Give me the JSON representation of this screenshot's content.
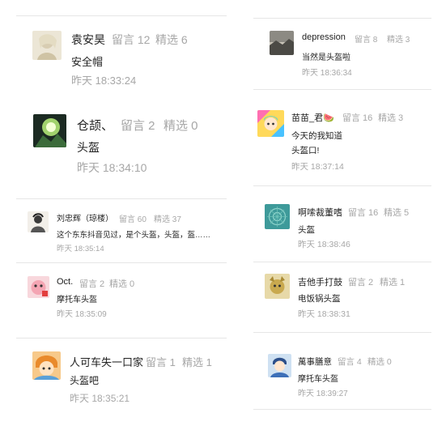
{
  "comments": [
    {
      "user": "袁安昊",
      "msgs": "留言 12",
      "picks": "精选 6",
      "lines": [
        "安全帽"
      ],
      "time": "昨天 18:33:24",
      "avatar": "beige-portrait-avatar"
    },
    {
      "user": "仓颉、",
      "msgs": "留言 2",
      "picks": "精选 0",
      "lines": [
        "头盔"
      ],
      "time": "昨天 18:34:10",
      "avatar": "green-glow-avatar"
    },
    {
      "user": "刘忠辉（琼楼）",
      "msgs": "留言 60",
      "picks": "精选 37",
      "lines": [
        "这个东东抖音见过，是个头盔，头盔，盔……"
      ],
      "time": "昨天 18:35:14",
      "avatar": "ink-portrait-avatar"
    },
    {
      "user": "Oct.",
      "msgs": "留言 2",
      "picks": "精选 0",
      "lines": [
        "摩托车头盔"
      ],
      "time": "昨天 18:35:09",
      "avatar": "pink-cartoon-avatar"
    },
    {
      "user": "人可车失一口家",
      "msgs": "留言 1",
      "picks": "精选 1",
      "lines": [
        "头盔吧"
      ],
      "time": "昨天 18:35:21",
      "avatar": "anime-boy-avatar"
    },
    {
      "user": "depression",
      "msgs": "留言 8",
      "picks": "精选 3",
      "lines": [
        "当然是头盔啦"
      ],
      "time": "昨天 18:36:34",
      "avatar": "landscape-avatar"
    },
    {
      "user": "苗苗_君🍉",
      "msgs": "留言 16",
      "picks": "精选 3",
      "lines": [
        "今天的我知道",
        "头盔口!"
      ],
      "time": "昨天 18:37:14",
      "avatar": "colorful-girl-avatar"
    },
    {
      "user": "啊嗦裁董嗜",
      "msgs": "留言 16",
      "picks": "精选 5",
      "lines": [
        "头盔"
      ],
      "time": "昨天 18:38:46",
      "avatar": "teal-pattern-avatar"
    },
    {
      "user": "吉他手打鼓",
      "msgs": "留言 2",
      "picks": "精选 1",
      "lines": [
        "电饭锅头盔"
      ],
      "time": "昨天 18:38:31",
      "avatar": "yellow-pet-avatar"
    },
    {
      "user": "萬事膳意",
      "msgs": "留言 4",
      "picks": "精选 0",
      "lines": [
        "摩托车头盔"
      ],
      "time": "昨天 18:39:27",
      "avatar": "blue-character-avatar"
    }
  ]
}
